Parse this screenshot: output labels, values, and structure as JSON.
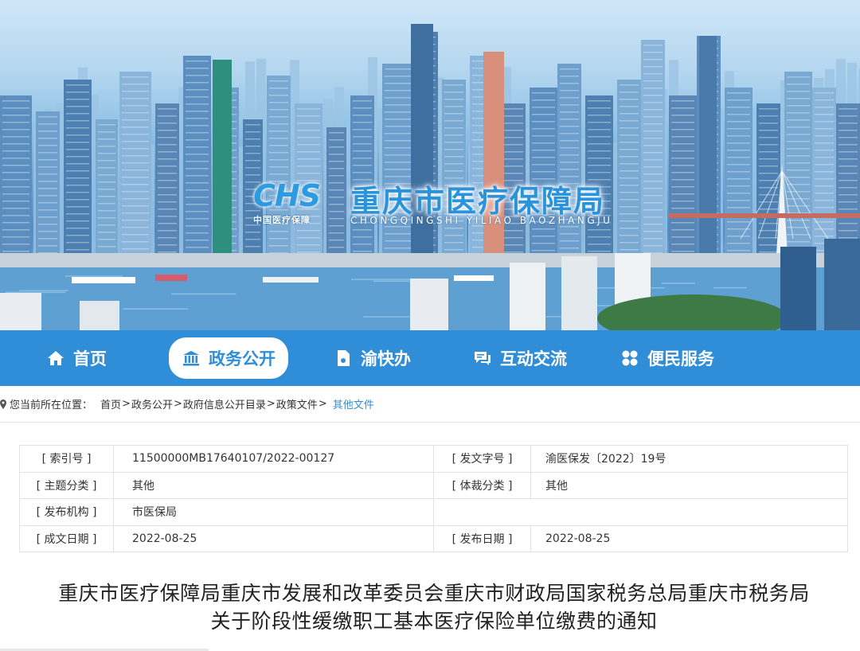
{
  "banner": {
    "logo_mark": "CHS",
    "logo_sub": "中国医疗保障",
    "title": "重庆市医疗保障局",
    "subtitle": "CHONGQINGSHI YILIAO BAOZHANGJU"
  },
  "nav": {
    "items": [
      {
        "label": "首页",
        "icon": "home-icon"
      },
      {
        "label": "政务公开",
        "icon": "building-icon",
        "active": true
      },
      {
        "label": "渝快办",
        "icon": "document-icon"
      },
      {
        "label": "互动交流",
        "icon": "chat-icon"
      },
      {
        "label": "便民服务",
        "icon": "grid-icon"
      }
    ],
    "color": "#2f8ed7"
  },
  "breadcrumb": {
    "label": "您当前所在位置：",
    "items": [
      "首页",
      "政务公开",
      "政府信息公开目录",
      "政策文件"
    ],
    "current": "其他文件"
  },
  "info": {
    "index_label": "[ 索引号 ]",
    "index_value": "11500000MB17640107/2022-00127",
    "doc_no_label": "[ 发文字号 ]",
    "doc_no_value": "渝医保发〔2022〕19号",
    "topic_label": "[ 主题分类 ]",
    "topic_value": "其他",
    "genre_label": "[ 体裁分类 ]",
    "genre_value": "其他",
    "publisher_label": "[ 发布机构 ]",
    "publisher_value": "市医保局",
    "created_label": "[ 成文日期 ]",
    "created_value": "2022-08-25",
    "published_label": "[ 发布日期 ]",
    "published_value": "2022-08-25"
  },
  "article": {
    "title_line1": "重庆市医疗保障局重庆市发展和改革委员会重庆市财政局国家税务总局重庆市税务局",
    "title_line2": "关于阶段性缓缴职工基本医疗保险单位缴费的通知"
  }
}
